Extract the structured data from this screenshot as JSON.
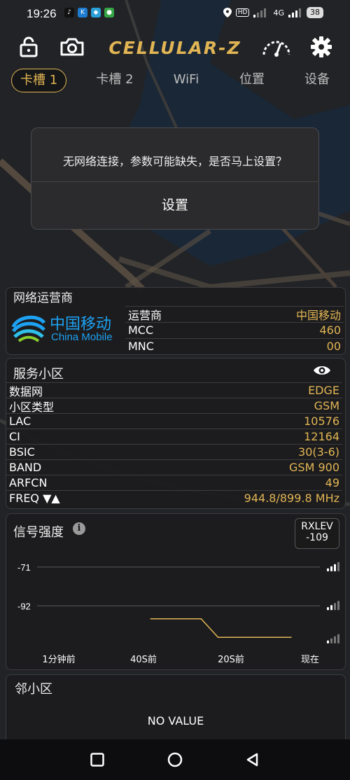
{
  "status_bar": {
    "time": "19:26",
    "app_icons": [
      "tiktok-icon",
      "k-app-icon",
      "blue-app-icon",
      "green-app-icon"
    ],
    "network": "4G",
    "battery": "38"
  },
  "toolbar": {
    "logo": "CELLULAR-Z",
    "icons": [
      "lock-icon",
      "camera-icon",
      "speedometer-icon",
      "gear-icon"
    ]
  },
  "tabs": [
    {
      "label": "卡槽 1",
      "active": true
    },
    {
      "label": "卡槽 2",
      "active": false
    },
    {
      "label": "WiFi",
      "active": false
    },
    {
      "label": "位置",
      "active": false
    },
    {
      "label": "设备",
      "active": false
    }
  ],
  "dialog": {
    "message": "无网络连接，参数可能缺失，是否马上设置？",
    "button": "设置"
  },
  "operator_card": {
    "title": "网络运营商",
    "logo_cn": "中国移动",
    "logo_en": "China Mobile",
    "rows": [
      {
        "key": "运营商",
        "value": "中国移动"
      },
      {
        "key": "MCC",
        "value": "460"
      },
      {
        "key": "MNC",
        "value": "00"
      }
    ]
  },
  "serving_cell": {
    "title": "服务小区",
    "rows": [
      {
        "key": "数据网",
        "value": "EDGE"
      },
      {
        "key": "小区类型",
        "value": "GSM"
      },
      {
        "key": "LAC",
        "value": "10576"
      },
      {
        "key": "CI",
        "value": "12164"
      },
      {
        "key": "BSIC",
        "value": "30(3-6)"
      },
      {
        "key": "BAND",
        "value": "GSM 900"
      },
      {
        "key": "ARFCN",
        "value": "49"
      },
      {
        "key": "FREQ ▼▲",
        "value": "944.8/899.8 MHz"
      }
    ]
  },
  "signal": {
    "title": "信号强度",
    "badge_label": "RXLEV",
    "badge_value": "-109",
    "y_labels": [
      "-71",
      "-92"
    ],
    "x_labels": [
      "1分钟前",
      "40S前",
      "20S前",
      "现在"
    ],
    "line_color": "#e2b554"
  },
  "chart_data": {
    "type": "line",
    "title": "信号强度",
    "xlabel": "",
    "ylabel": "",
    "x": [
      "1分钟前",
      "40S前",
      "20S前",
      "现在"
    ],
    "yticks": [
      -71,
      -92
    ],
    "series": [
      {
        "name": "RXLEV",
        "points": [
          [
            0.4,
            -99
          ],
          [
            0.58,
            -99
          ],
          [
            0.64,
            -109
          ],
          [
            0.9,
            -109
          ]
        ]
      }
    ],
    "ylim": [
      -115,
      -65
    ],
    "grid": true
  },
  "neighbor": {
    "title": "邻小区",
    "empty": "NO VALUE"
  },
  "navbar": {
    "icons": [
      "square-icon",
      "circle-icon",
      "triangle-back-icon"
    ]
  },
  "colors": {
    "accent": "#e2b554",
    "background": "#1f2124"
  }
}
